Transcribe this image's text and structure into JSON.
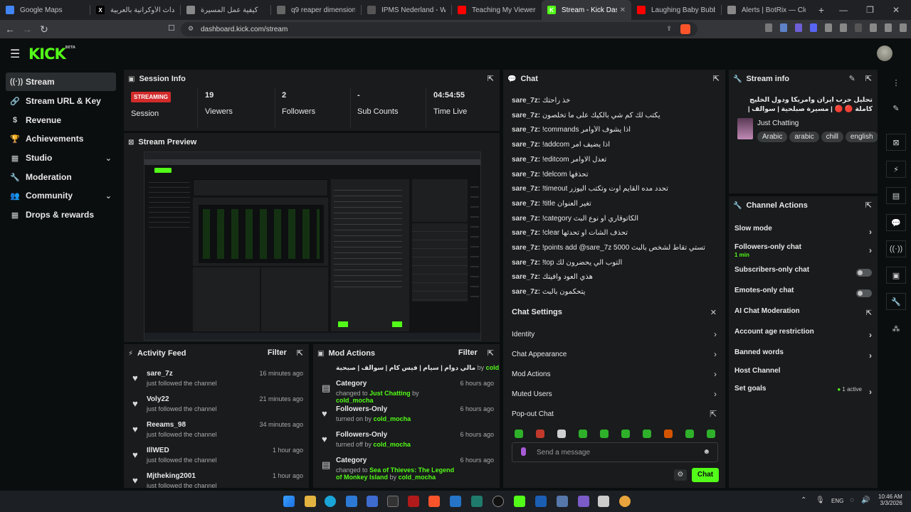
{
  "browser": {
    "tabs": [
      {
        "title": "Google Maps",
        "color": "#4285f4"
      },
      {
        "title": "الأحداث الأوكرانية بالعربية (@",
        "color": "#000000",
        "glyph": "X"
      },
      {
        "title": "كيفية عمل المسيرة",
        "color": "#888888"
      },
      {
        "title": "q9 reaper dimensions - Go",
        "color": "#666666"
      },
      {
        "title": "IPMS Nederland - Walk aro",
        "color": "#555555"
      },
      {
        "title": "Teaching My Viewers How",
        "color": "#ff0000"
      },
      {
        "title": "Stream - Kick Dashbo",
        "color": "#53fc18",
        "glyph": "K"
      },
      {
        "title": "Laughing Baby Bubbling F",
        "color": "#ff0000"
      },
      {
        "title": "Alerts | BotRix — Cloud St",
        "color": "#888888"
      }
    ],
    "new_tab": "+",
    "url": "dashboard.kick.com/stream"
  },
  "app": {
    "logo": "KICK",
    "logo_sup": "BETA"
  },
  "sidebar": {
    "items": [
      {
        "label": "Stream",
        "icon": "stream-icon",
        "glyph": "((·))"
      },
      {
        "label": "Stream URL & Key",
        "icon": "link-icon",
        "glyph": "🔗"
      },
      {
        "label": "Revenue",
        "icon": "dollar-icon",
        "glyph": "$"
      },
      {
        "label": "Achievements",
        "icon": "trophy-icon",
        "glyph": "🏆"
      },
      {
        "label": "Studio",
        "icon": "grid-icon",
        "glyph": "▦"
      },
      {
        "label": "Moderation",
        "icon": "wrench-icon",
        "glyph": "🔧"
      },
      {
        "label": "Community",
        "icon": "users-icon",
        "glyph": "👥"
      },
      {
        "label": "Drops & rewards",
        "icon": "gift-icon",
        "glyph": "▦"
      }
    ]
  },
  "session": {
    "title": "Session Info",
    "badge": "STREAMING",
    "session_label": "Session",
    "viewers": "19",
    "viewers_label": "Viewers",
    "followers": "2",
    "followers_label": "Followers",
    "subs": "-",
    "subs_label": "Sub Counts",
    "time": "04:54:55",
    "time_label": "Time Live"
  },
  "preview": {
    "title": "Stream Preview"
  },
  "activity": {
    "title": "Activity Feed",
    "filter": "Filter",
    "rows": [
      {
        "name": "sare_7z",
        "sub": "just followed the channel",
        "time": "16 minutes ago"
      },
      {
        "name": "Voly22",
        "sub": "just followed the channel",
        "time": "21 minutes ago"
      },
      {
        "name": "Reeams_98",
        "sub": "just followed the channel",
        "time": "34 minutes ago"
      },
      {
        "name": "IllWED",
        "sub": "just followed the channel",
        "time": "1 hour ago"
      },
      {
        "name": "Mjtheking2001",
        "sub": "just followed the channel",
        "time": "1 hour ago"
      }
    ]
  },
  "mod": {
    "title": "Mod Actions",
    "filter": "Filter",
    "top_line_text": "مالي دوام | سيام | فيس كام | سوالف | صبحية",
    "top_line_by": "by",
    "top_line_user": "cold_mocha",
    "rows": [
      {
        "name": "Category",
        "pre": "changed to",
        "value": "Just Chatting",
        "by": "by",
        "user": "cold_mocha",
        "time": "6 hours ago"
      },
      {
        "name": "Followers-Only",
        "pre": "turned on by",
        "value": "",
        "by": "",
        "user": "cold_mocha",
        "time": "6 hours ago"
      },
      {
        "name": "Followers-Only",
        "pre": "turned off by",
        "value": "",
        "by": "",
        "user": "cold_mocha",
        "time": "6 hours ago"
      },
      {
        "name": "Category",
        "pre": "changed to",
        "value": "Sea of Thieves: The Legend of Monkey Island",
        "by": "by",
        "user": "cold_mocha",
        "time": "6 hours ago"
      }
    ]
  },
  "chat": {
    "title": "Chat",
    "lines": [
      {
        "user": "sare_7z:",
        "text": "خذ راحتك"
      },
      {
        "user": "sare_7z:",
        "text": "يكتب لك كم شي بالكيك على ما تخلصون"
      },
      {
        "user": "sare_7z:",
        "text": "!commands اذا يشوف الأوامر"
      },
      {
        "user": "sare_7z:",
        "text": "!addcom اذا يضيف امر"
      },
      {
        "user": "sare_7z:",
        "text": "!editcom تعدل الاوامر"
      },
      {
        "user": "sare_7z:",
        "text": "!delcom تحذفها"
      },
      {
        "user": "sare_7z:",
        "text": "!timeout تحدد مده القايم اوت وتكتب اليوزر"
      },
      {
        "user": "sare_7z:",
        "text": "!title تغير العنوان"
      },
      {
        "user": "sare_7z:",
        "text": "!category الكاتوقاري او نوع البث"
      },
      {
        "user": "sare_7z:",
        "text": "!clear تحذف الشات او تحدثها"
      },
      {
        "user": "sare_7z:",
        "text": "!points add @sare_7z 5000 تستي تقاط لشخص بالبث"
      },
      {
        "user": "sare_7z:",
        "text": "!top التوب الي يحضرون لك"
      },
      {
        "user": "sare_7z:",
        "text": "هذي العود وافيتك"
      },
      {
        "user": "sare_7z:",
        "text": "يتحكمون بالبث"
      }
    ],
    "settings_title": "Chat Settings",
    "settings": [
      {
        "label": "Identity"
      },
      {
        "label": "Chat Appearance"
      },
      {
        "label": "Mod Actions"
      },
      {
        "label": "Muted Users"
      },
      {
        "label": "Pop-out Chat"
      }
    ],
    "input_placeholder": "Send a message",
    "send_label": "Chat"
  },
  "stream_info": {
    "title": "Stream info",
    "stream_title": "تحليل حرب ايران وامريكا ودول الخليج كاملة 🔴 🔴 | مسيرة صبلحية | سوالف | فيس كام | سيام | مالي دوام",
    "category": "Just Chatting",
    "tags": [
      "Arabic",
      "arabic",
      "chill",
      "english"
    ]
  },
  "channel_actions": {
    "title": "Channel Actions",
    "rows": [
      {
        "label": "Slow mode",
        "kind": "chevron"
      },
      {
        "label": "Followers-only chat",
        "sub": "1 min",
        "kind": "chevron"
      },
      {
        "label": "Subscribers-only chat",
        "kind": "toggle"
      },
      {
        "label": "Emotes-only chat",
        "kind": "toggle"
      },
      {
        "label": "AI Chat Moderation",
        "kind": "external"
      },
      {
        "label": "Account age restriction",
        "kind": "chevron"
      },
      {
        "label": "Banned words",
        "kind": "chevron"
      },
      {
        "label": "Host Channel",
        "kind": "none"
      },
      {
        "label": "Set goals",
        "kind": "chevron",
        "status": "1 active"
      }
    ]
  },
  "taskbar": {
    "lang": "ENG",
    "time": "10:46 AM",
    "date": "3/3/2026"
  },
  "colors": {
    "accent": "#53fc18",
    "live": "#d32b2b",
    "panel": "#191b1c",
    "bg": "#0b0e0f"
  }
}
